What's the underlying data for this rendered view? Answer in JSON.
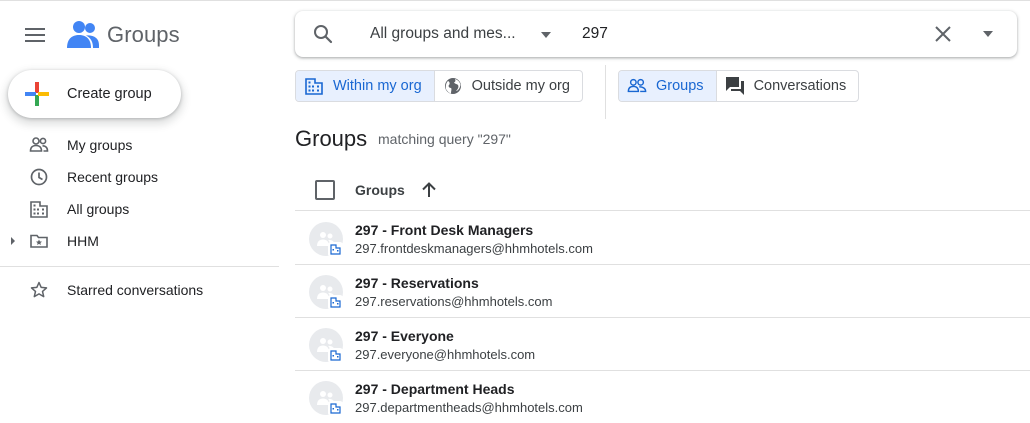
{
  "app": {
    "title": "Groups",
    "brand_colors": {
      "blue": "#4285f4",
      "red": "#ea4335",
      "yellow": "#fbbc04",
      "green": "#34a853",
      "accent": "#1967d2"
    }
  },
  "sidebar": {
    "create_label": "Create group",
    "items": [
      {
        "label": "My groups",
        "icon": "people-outline-icon"
      },
      {
        "label": "Recent groups",
        "icon": "clock-icon"
      },
      {
        "label": "All groups",
        "icon": "building-icon"
      },
      {
        "label": "HHM",
        "icon": "folder-star-icon",
        "expandable": true
      }
    ],
    "starred": {
      "label": "Starred conversations",
      "icon": "star-outline-icon"
    }
  },
  "search": {
    "scope_label": "All groups and mes...",
    "query": "297"
  },
  "filters": {
    "org": [
      {
        "label": "Within my org",
        "selected": true,
        "icon": "building-icon"
      },
      {
        "label": "Outside my org",
        "selected": false,
        "icon": "globe-icon"
      }
    ],
    "type": [
      {
        "label": "Groups",
        "selected": true,
        "icon": "people-outline-icon"
      },
      {
        "label": "Conversations",
        "selected": false,
        "icon": "forum-icon"
      }
    ]
  },
  "results": {
    "heading": "Groups",
    "subheading": "matching query \"297\"",
    "column_label": "Groups",
    "sort": "ascending",
    "rows": [
      {
        "name": "297 - Front Desk Managers",
        "email": "297.frontdeskmanagers@hhmhotels.com"
      },
      {
        "name": "297 - Reservations",
        "email": "297.reservations@hhmhotels.com"
      },
      {
        "name": "297 - Everyone",
        "email": "297.everyone@hhmhotels.com"
      },
      {
        "name": "297 - Department Heads",
        "email": "297.departmentheads@hhmhotels.com"
      }
    ]
  }
}
